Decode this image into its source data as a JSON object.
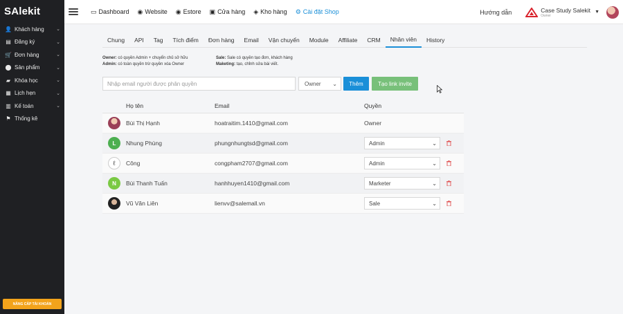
{
  "app": {
    "logo": "SAlekit"
  },
  "sidebar": {
    "items": [
      {
        "label": "Khách hàng",
        "icon": "user-icon",
        "glyph": "👤",
        "has_children": true
      },
      {
        "label": "Đăng ký",
        "icon": "form-icon",
        "glyph": "▤",
        "has_children": true
      },
      {
        "label": "Đơn hàng",
        "icon": "cart-icon",
        "glyph": "🛒",
        "has_children": true
      },
      {
        "label": "Sản phẩm",
        "icon": "product-icon",
        "glyph": "⬤",
        "has_children": true
      },
      {
        "label": "Khóa học",
        "icon": "book-icon",
        "glyph": "▰",
        "has_children": true
      },
      {
        "label": "Lịch hẹn",
        "icon": "calendar-icon",
        "glyph": "▦",
        "has_children": true
      },
      {
        "label": "Kế toán",
        "icon": "accounting-icon",
        "glyph": "▥",
        "has_children": true
      },
      {
        "label": "Thống kê",
        "icon": "flag-icon",
        "glyph": "⚑",
        "has_children": false
      }
    ],
    "upgrade_label": "NÂNG CẤP TÀI KHOẢN"
  },
  "topbar": {
    "nav": [
      {
        "label": "Dashboard",
        "icon": "monitor-icon",
        "glyph": "▭",
        "active": false
      },
      {
        "label": "Website",
        "icon": "globe-icon",
        "glyph": "◉",
        "active": false
      },
      {
        "label": "Estore",
        "icon": "estore-icon",
        "glyph": "◉",
        "active": false
      },
      {
        "label": "Cửa hàng",
        "icon": "store-icon",
        "glyph": "▣",
        "active": false
      },
      {
        "label": "Kho hàng",
        "icon": "cubes-icon",
        "glyph": "◈",
        "active": false
      },
      {
        "label": "Cài đặt Shop",
        "icon": "gear-icon",
        "glyph": "⚙",
        "active": true
      }
    ],
    "help_label": "Hướng dẫn",
    "account_name": "Case Study Salekit",
    "account_role": "Owner"
  },
  "settings": {
    "tabs": [
      {
        "label": "Chung",
        "active": false
      },
      {
        "label": "API",
        "active": false
      },
      {
        "label": "Tag",
        "active": false
      },
      {
        "label": "Tích điểm",
        "active": false
      },
      {
        "label": "Đơn hàng",
        "active": false
      },
      {
        "label": "Email",
        "active": false
      },
      {
        "label": "Vận chuyển",
        "active": false
      },
      {
        "label": "Module",
        "active": false
      },
      {
        "label": "Affiliate",
        "active": false
      },
      {
        "label": "CRM",
        "active": false
      },
      {
        "label": "Nhân viên",
        "active": true
      },
      {
        "label": "History",
        "active": false
      }
    ],
    "permissions": {
      "owner_key": "Owner:",
      "owner_desc": " có quyền Admin + chuyển chủ sở hữu",
      "admin_key": "Admin:",
      "admin_desc": " có toàn quyền trừ quyền xóa Owner",
      "sale_key": "Sale:",
      "sale_desc": " Sale có quyền tạo đơn, khách hàng",
      "marketing_key": "Maketing:",
      "marketing_desc": " tạo, chỉnh sửa bài viết."
    },
    "invite": {
      "placeholder": "Nhập email người được phân quyền",
      "role_value": "Owner",
      "add_label": "Thêm",
      "invite_link_label": "Tạo link invite"
    },
    "table": {
      "headers": {
        "name": "Họ tên",
        "email": "Email",
        "role": "Quyền"
      },
      "rows": [
        {
          "avatar": "photo1",
          "initial": "",
          "name": "Bùi Thị Hạnh",
          "email": "hoatraitim.1410@gmail.com",
          "role": "Owner",
          "editable": false
        },
        {
          "avatar": "green",
          "initial": "L",
          "name": "Nhung Phùng",
          "email": "phungnhungtsd@gmail.com",
          "role": "Admin",
          "editable": true
        },
        {
          "avatar": "photo2",
          "initial": "ℓ",
          "name": "Công",
          "email": "congpham2707@gmail.com",
          "role": "Admin",
          "editable": true
        },
        {
          "avatar": "lime",
          "initial": "N",
          "name": "Bùi Thanh Tuấn",
          "email": "hanhhuyen1410@gmail.com",
          "role": "Marketer",
          "editable": true
        },
        {
          "avatar": "photo3",
          "initial": "",
          "name": "Vũ Văn Liên",
          "email": "lienvv@salemall.vn",
          "role": "Sale",
          "editable": true
        }
      ]
    }
  },
  "colors": {
    "sidebar_bg": "#1f2023",
    "accent": "#1a8fd8",
    "invite_green": "#78c07a",
    "delete_red": "#e05353",
    "upgrade_orange": "#f3a31b"
  }
}
